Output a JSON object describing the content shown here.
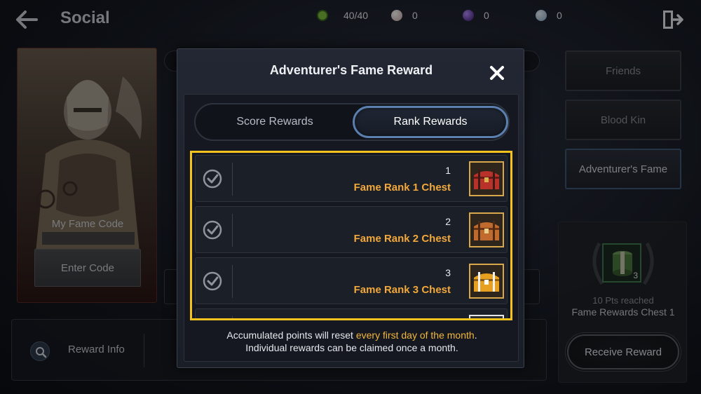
{
  "header": {
    "title": "Social",
    "currencies": [
      {
        "icon": "stamina-icon",
        "value": "40/40",
        "color": "#7fbf3f"
      },
      {
        "icon": "pearl-icon",
        "value": "0",
        "color": "#c9a9a9"
      },
      {
        "icon": "dark-orb-icon",
        "value": "0",
        "color": "#6a3fbf"
      },
      {
        "icon": "silver-coin-icon",
        "value": "0",
        "color": "#a9c3d9"
      }
    ]
  },
  "profile": {
    "fame_code_label": "My Fame Code",
    "enter_code_label": "Enter Code"
  },
  "side_menu": {
    "items": [
      {
        "label": "Friends",
        "active": false
      },
      {
        "label": "Blood Kin",
        "active": false
      },
      {
        "label": "Adventurer's Fame",
        "active": true
      }
    ]
  },
  "reward_panel": {
    "chest_count": "3",
    "pts_text": "10 Pts reached",
    "chest_name": "Fame Rewards Chest 1",
    "receive_label": "Receive Reward"
  },
  "info_bar": {
    "label": "Reward Info"
  },
  "modal": {
    "title": "Adventurer's Fame Reward",
    "tabs": [
      {
        "label": "Score Rewards",
        "selected": false
      },
      {
        "label": "Rank Rewards",
        "selected": true
      }
    ],
    "rewards": [
      {
        "rank": "1",
        "name": "Fame Rank 1 Chest",
        "chest_color": "#b8322a"
      },
      {
        "rank": "2",
        "name": "Fame Rank 2 Chest",
        "chest_color": "#c06a2e"
      },
      {
        "rank": "3",
        "name": "Fame Rank 3 Chest",
        "chest_color": "#e8a020"
      }
    ],
    "footer_line1_pre": "Accumulated points will reset ",
    "footer_line1_highlight": "every first day of the month",
    "footer_line1_post": ".",
    "footer_line2": "Individual rewards can be claimed once a month."
  },
  "colors": {
    "highlight": "#f4c21c",
    "reward_name": "#f2a83a",
    "active_tab_border": "#5b7fae"
  }
}
